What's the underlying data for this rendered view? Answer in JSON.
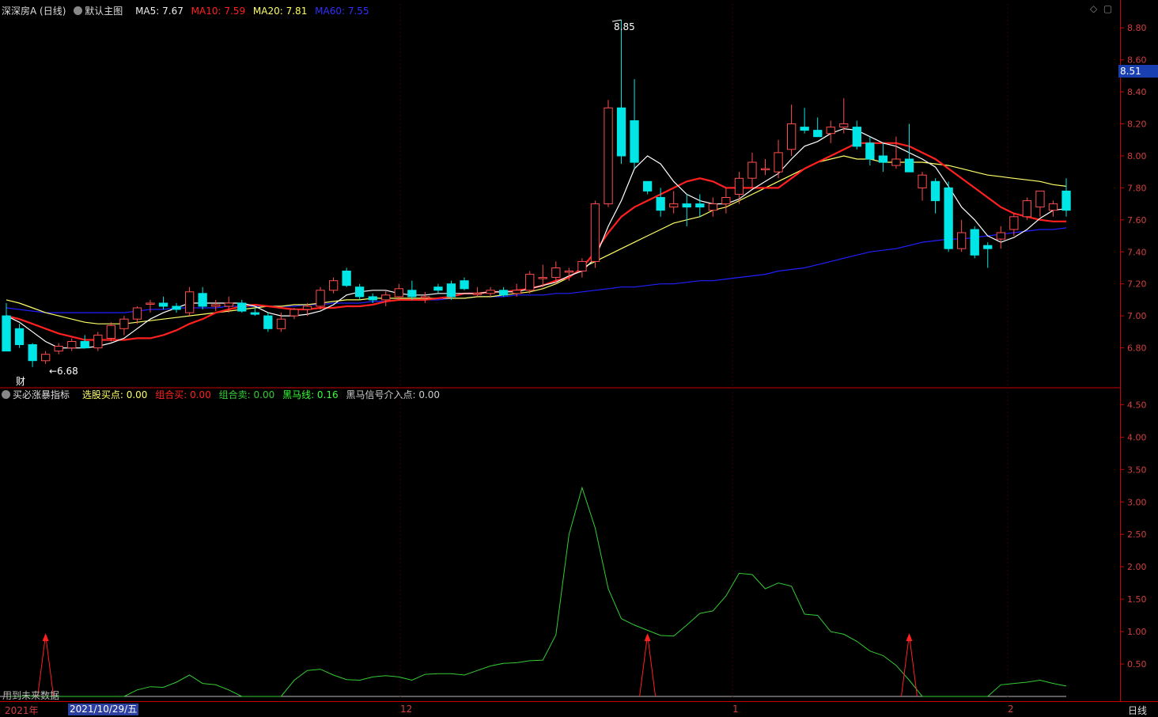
{
  "header": {
    "stock": "深深房A (日线)",
    "main_chart": "默认主图",
    "ma5": "MA5: 7.67",
    "ma10": "MA10: 7.59",
    "ma20": "MA20: 7.81",
    "ma60": "MA60: 7.55"
  },
  "indicator": {
    "name": "买必涨暴指标",
    "buy_point": "选股买点: 0.00",
    "combo_buy": "组合买: 0.00",
    "combo_sell": "组合卖: 0.00",
    "dark_horse": "黑马线: 0.16",
    "dark_horse_signal": "黑马信号介入点: 0.00"
  },
  "marks": {
    "high_label": "8.85",
    "low_label": "←6.68",
    "cai": "财",
    "future_note": "用到未来数据"
  },
  "current_price": "8.51",
  "bottom": {
    "year": "2021年",
    "date": "2021/10/29/五",
    "ticks": [
      "12",
      "1",
      "2"
    ],
    "period": "日线"
  },
  "colors": {
    "up": "#ff4d4d",
    "down": "#00e5e5",
    "ma5": "#ffffff",
    "ma10": "#ff2020",
    "ma20": "#ffff66",
    "ma60": "#2020ff",
    "line": "#33cc33",
    "signal": "#ff2020"
  },
  "chart_data": [
    {
      "type": "candlestick",
      "ylim": [
        6.6,
        8.9
      ],
      "yticks": [
        6.8,
        7.0,
        7.2,
        7.4,
        7.6,
        7.8,
        8.0,
        8.2,
        8.4,
        8.6,
        8.8
      ],
      "ohlc": [
        [
          7.0,
          7.08,
          6.78,
          6.78
        ],
        [
          6.92,
          6.95,
          6.8,
          6.82
        ],
        [
          6.82,
          6.83,
          6.68,
          6.72
        ],
        [
          6.72,
          6.78,
          6.7,
          6.76
        ],
        [
          6.78,
          6.83,
          6.76,
          6.81
        ],
        [
          6.8,
          6.86,
          6.78,
          6.84
        ],
        [
          6.84,
          6.88,
          6.8,
          6.8
        ],
        [
          6.8,
          6.9,
          6.78,
          6.88
        ],
        [
          6.86,
          6.96,
          6.84,
          6.94
        ],
        [
          6.92,
          7.0,
          6.88,
          6.98
        ],
        [
          6.98,
          7.06,
          6.95,
          7.05
        ],
        [
          7.08,
          7.1,
          7.02,
          7.08
        ],
        [
          7.08,
          7.12,
          7.04,
          7.06
        ],
        [
          7.06,
          7.08,
          7.02,
          7.04
        ],
        [
          7.02,
          7.18,
          7.0,
          7.15
        ],
        [
          7.14,
          7.18,
          7.04,
          7.06
        ],
        [
          7.06,
          7.1,
          7.03,
          7.07
        ],
        [
          7.06,
          7.12,
          7.02,
          7.08
        ],
        [
          7.08,
          7.1,
          7.02,
          7.03
        ],
        [
          7.02,
          7.05,
          7.0,
          7.01
        ],
        [
          7.0,
          7.02,
          6.9,
          6.92
        ],
        [
          6.92,
          7.02,
          6.9,
          6.98
        ],
        [
          7.0,
          7.05,
          6.98,
          7.04
        ],
        [
          7.04,
          7.08,
          7.0,
          7.06
        ],
        [
          7.06,
          7.18,
          7.04,
          7.16
        ],
        [
          7.16,
          7.24,
          7.14,
          7.22
        ],
        [
          7.28,
          7.3,
          7.18,
          7.19
        ],
        [
          7.18,
          7.2,
          7.1,
          7.12
        ],
        [
          7.12,
          7.14,
          7.08,
          7.1
        ],
        [
          7.1,
          7.16,
          7.06,
          7.13
        ],
        [
          7.12,
          7.2,
          7.1,
          7.17
        ],
        [
          7.16,
          7.22,
          7.1,
          7.12
        ],
        [
          7.12,
          7.15,
          7.08,
          7.12
        ],
        [
          7.18,
          7.2,
          7.14,
          7.16
        ],
        [
          7.2,
          7.22,
          7.1,
          7.12
        ],
        [
          7.22,
          7.24,
          7.16,
          7.17
        ],
        [
          7.14,
          7.18,
          7.12,
          7.14
        ],
        [
          7.14,
          7.18,
          7.12,
          7.16
        ],
        [
          7.16,
          7.18,
          7.12,
          7.13
        ],
        [
          7.14,
          7.2,
          7.12,
          7.16
        ],
        [
          7.16,
          7.28,
          7.14,
          7.26
        ],
        [
          7.24,
          7.32,
          7.18,
          7.24
        ],
        [
          7.24,
          7.34,
          7.2,
          7.3
        ],
        [
          7.28,
          7.3,
          7.22,
          7.28
        ],
        [
          7.28,
          7.36,
          7.24,
          7.34
        ],
        [
          7.34,
          7.72,
          7.3,
          7.7
        ],
        [
          7.7,
          8.35,
          7.68,
          8.3
        ],
        [
          8.3,
          8.85,
          7.95,
          8.0
        ],
        [
          8.22,
          8.48,
          7.92,
          7.96
        ],
        [
          7.84,
          7.84,
          7.76,
          7.78
        ],
        [
          7.74,
          7.8,
          7.62,
          7.66
        ],
        [
          7.68,
          7.78,
          7.64,
          7.7
        ],
        [
          7.7,
          7.76,
          7.56,
          7.68
        ],
        [
          7.7,
          7.76,
          7.62,
          7.68
        ],
        [
          7.66,
          7.74,
          7.62,
          7.7
        ],
        [
          7.7,
          7.8,
          7.64,
          7.74
        ],
        [
          7.76,
          7.9,
          7.7,
          7.86
        ],
        [
          7.86,
          8.02,
          7.8,
          7.96
        ],
        [
          7.92,
          7.98,
          7.88,
          7.92
        ],
        [
          7.9,
          8.1,
          7.86,
          8.02
        ],
        [
          8.04,
          8.32,
          8.0,
          8.2
        ],
        [
          8.18,
          8.3,
          8.14,
          8.16
        ],
        [
          8.16,
          8.24,
          8.12,
          8.12
        ],
        [
          8.14,
          8.22,
          8.08,
          8.18
        ],
        [
          8.18,
          8.36,
          8.14,
          8.2
        ],
        [
          8.18,
          8.22,
          8.04,
          8.06
        ],
        [
          8.08,
          8.12,
          7.94,
          7.98
        ],
        [
          8.0,
          8.08,
          7.9,
          7.96
        ],
        [
          7.94,
          8.12,
          7.92,
          7.98
        ],
        [
          7.98,
          8.2,
          7.94,
          7.9
        ],
        [
          7.8,
          7.9,
          7.72,
          7.88
        ],
        [
          7.84,
          7.86,
          7.64,
          7.72
        ],
        [
          7.8,
          7.84,
          7.4,
          7.42
        ],
        [
          7.42,
          7.6,
          7.4,
          7.52
        ],
        [
          7.54,
          7.56,
          7.36,
          7.38
        ],
        [
          7.44,
          7.46,
          7.3,
          7.42
        ],
        [
          7.48,
          7.56,
          7.42,
          7.52
        ],
        [
          7.54,
          7.64,
          7.5,
          7.62
        ],
        [
          7.62,
          7.74,
          7.6,
          7.72
        ],
        [
          7.68,
          7.78,
          7.62,
          7.78
        ],
        [
          7.66,
          7.72,
          7.62,
          7.7
        ],
        [
          7.78,
          7.86,
          7.62,
          7.66
        ]
      ],
      "ma5": [
        7.0,
        6.96,
        6.9,
        6.84,
        6.8,
        6.8,
        6.8,
        6.81,
        6.83,
        6.86,
        6.92,
        6.98,
        7.02,
        7.05,
        7.08,
        7.08,
        7.08,
        7.08,
        7.08,
        7.06,
        7.02,
        7.0,
        7.0,
        7.01,
        7.03,
        7.07,
        7.13,
        7.15,
        7.16,
        7.16,
        7.14,
        7.13,
        7.13,
        7.14,
        7.14,
        7.14,
        7.14,
        7.15,
        7.15,
        7.15,
        7.17,
        7.19,
        7.21,
        7.25,
        7.28,
        7.36,
        7.56,
        7.72,
        7.92,
        8.0,
        7.95,
        7.84,
        7.76,
        7.72,
        7.7,
        7.7,
        7.73,
        7.79,
        7.84,
        7.89,
        7.98,
        8.06,
        8.09,
        8.14,
        8.17,
        8.16,
        8.12,
        8.08,
        8.06,
        8.02,
        7.98,
        7.93,
        7.81,
        7.68,
        7.6,
        7.5,
        7.46,
        7.49,
        7.54,
        7.61,
        7.66,
        7.67
      ],
      "ma10": [
        7.0,
        6.98,
        6.95,
        6.92,
        6.89,
        6.87,
        6.85,
        6.85,
        6.85,
        6.85,
        6.86,
        6.86,
        6.88,
        6.91,
        6.95,
        6.98,
        7.02,
        7.04,
        7.06,
        7.07,
        7.06,
        7.05,
        7.04,
        7.04,
        7.05,
        7.05,
        7.06,
        7.06,
        7.07,
        7.09,
        7.1,
        7.1,
        7.1,
        7.11,
        7.12,
        7.14,
        7.14,
        7.15,
        7.15,
        7.16,
        7.17,
        7.19,
        7.22,
        7.24,
        7.3,
        7.4,
        7.52,
        7.62,
        7.68,
        7.72,
        7.76,
        7.8,
        7.84,
        7.86,
        7.84,
        7.8,
        7.8,
        7.8,
        7.8,
        7.8,
        7.86,
        7.92,
        7.96,
        8.0,
        8.04,
        8.08,
        8.08,
        8.08,
        8.08,
        8.06,
        8.02,
        7.98,
        7.92,
        7.86,
        7.8,
        7.74,
        7.68,
        7.64,
        7.62,
        7.6,
        7.59,
        7.59
      ],
      "ma20": [
        7.1,
        7.08,
        7.05,
        7.02,
        7.0,
        6.98,
        6.96,
        6.95,
        6.95,
        6.95,
        6.96,
        6.97,
        6.98,
        6.99,
        7.0,
        7.01,
        7.02,
        7.03,
        7.04,
        7.05,
        7.06,
        7.06,
        7.07,
        7.07,
        7.08,
        7.09,
        7.1,
        7.1,
        7.11,
        7.11,
        7.11,
        7.11,
        7.11,
        7.11,
        7.11,
        7.11,
        7.12,
        7.12,
        7.13,
        7.14,
        7.15,
        7.17,
        7.2,
        7.24,
        7.3,
        7.34,
        7.38,
        7.42,
        7.46,
        7.5,
        7.54,
        7.58,
        7.6,
        7.62,
        7.66,
        7.68,
        7.72,
        7.76,
        7.8,
        7.84,
        7.88,
        7.92,
        7.96,
        7.98,
        8.0,
        7.98,
        7.98,
        7.96,
        7.96,
        7.96,
        7.96,
        7.95,
        7.94,
        7.92,
        7.9,
        7.88,
        7.87,
        7.86,
        7.85,
        7.84,
        7.82,
        7.81
      ],
      "ma60": [
        7.05,
        7.04,
        7.03,
        7.02,
        7.02,
        7.02,
        7.02,
        7.02,
        7.02,
        7.02,
        7.03,
        7.04,
        7.04,
        7.05,
        7.05,
        7.05,
        7.05,
        7.06,
        7.06,
        7.06,
        7.06,
        7.06,
        7.06,
        7.07,
        7.07,
        7.08,
        7.08,
        7.08,
        7.09,
        7.09,
        7.1,
        7.1,
        7.1,
        7.1,
        7.11,
        7.11,
        7.12,
        7.12,
        7.12,
        7.13,
        7.13,
        7.13,
        7.14,
        7.14,
        7.15,
        7.16,
        7.17,
        7.18,
        7.18,
        7.19,
        7.2,
        7.2,
        7.21,
        7.22,
        7.22,
        7.23,
        7.24,
        7.25,
        7.26,
        7.28,
        7.29,
        7.3,
        7.32,
        7.34,
        7.36,
        7.38,
        7.4,
        7.41,
        7.42,
        7.44,
        7.46,
        7.47,
        7.48,
        7.48,
        7.49,
        7.5,
        7.51,
        7.52,
        7.53,
        7.54,
        7.54,
        7.55
      ]
    },
    {
      "type": "line",
      "ylim": [
        0,
        4.7
      ],
      "yticks": [
        0.5,
        1.0,
        1.5,
        2.0,
        2.5,
        3.0,
        3.5,
        4.0,
        4.5
      ],
      "dark_horse_line": [
        0,
        0,
        0,
        0,
        0,
        0,
        0,
        0,
        0,
        0,
        0.1,
        0.15,
        0.14,
        0.22,
        0.33,
        0.2,
        0.18,
        0.1,
        0,
        0,
        0,
        0,
        0.25,
        0.4,
        0.42,
        0.33,
        0.26,
        0.25,
        0.3,
        0.32,
        0.3,
        0.25,
        0.34,
        0.35,
        0.35,
        0.33,
        0.4,
        0.47,
        0.51,
        0.52,
        0.55,
        0.56,
        0.95,
        2.5,
        3.22,
        2.6,
        1.66,
        1.2,
        1.1,
        1.02,
        0.94,
        0.93,
        1.1,
        1.28,
        1.32,
        1.55,
        1.9,
        1.88,
        1.66,
        1.75,
        1.7,
        1.27,
        1.25,
        1.0,
        0.96,
        0.85,
        0.7,
        0.63,
        0.48,
        0.25,
        0,
        0,
        0,
        0,
        0,
        0,
        0.18,
        0.2,
        0.22,
        0.25,
        0.2,
        0.16
      ],
      "signals": [
        3,
        49,
        69
      ]
    }
  ]
}
